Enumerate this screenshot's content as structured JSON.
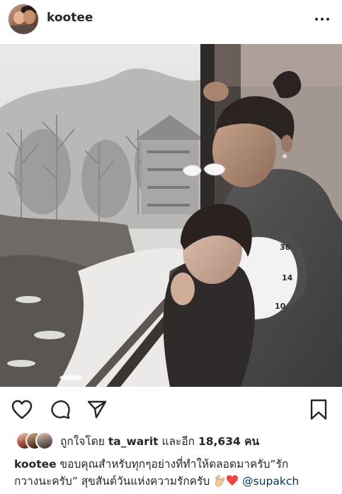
{
  "header": {
    "username": "kootee",
    "avatar_icon": "profile-avatar",
    "more_icon": "more-horizontal-icon"
  },
  "photo": {
    "description_icon": "post-photo"
  },
  "actions": {
    "like_icon": "heart-outline-icon",
    "comment_icon": "comment-bubble-icon",
    "share_icon": "send-paper-plane-icon",
    "save_icon": "bookmark-icon"
  },
  "likes": {
    "prefix": "ถูกใจโดย ",
    "top_liker": "ta_warit",
    "middle": " และอีก ",
    "count": "18,634",
    "suffix": " คน"
  },
  "caption": {
    "username": "kootee",
    "line1": " ขอบคุณสำหรับทุกๆอย่างที่ทำให้ตลอดมาครับ”รัก",
    "line2": "กวางนะครับ” สุขสันต์วันแห่งความรักครับ",
    "mention": "@supakch"
  },
  "colors": {
    "text": "#262626",
    "mention": "#003569",
    "heart_emoji": "#f0433a"
  }
}
